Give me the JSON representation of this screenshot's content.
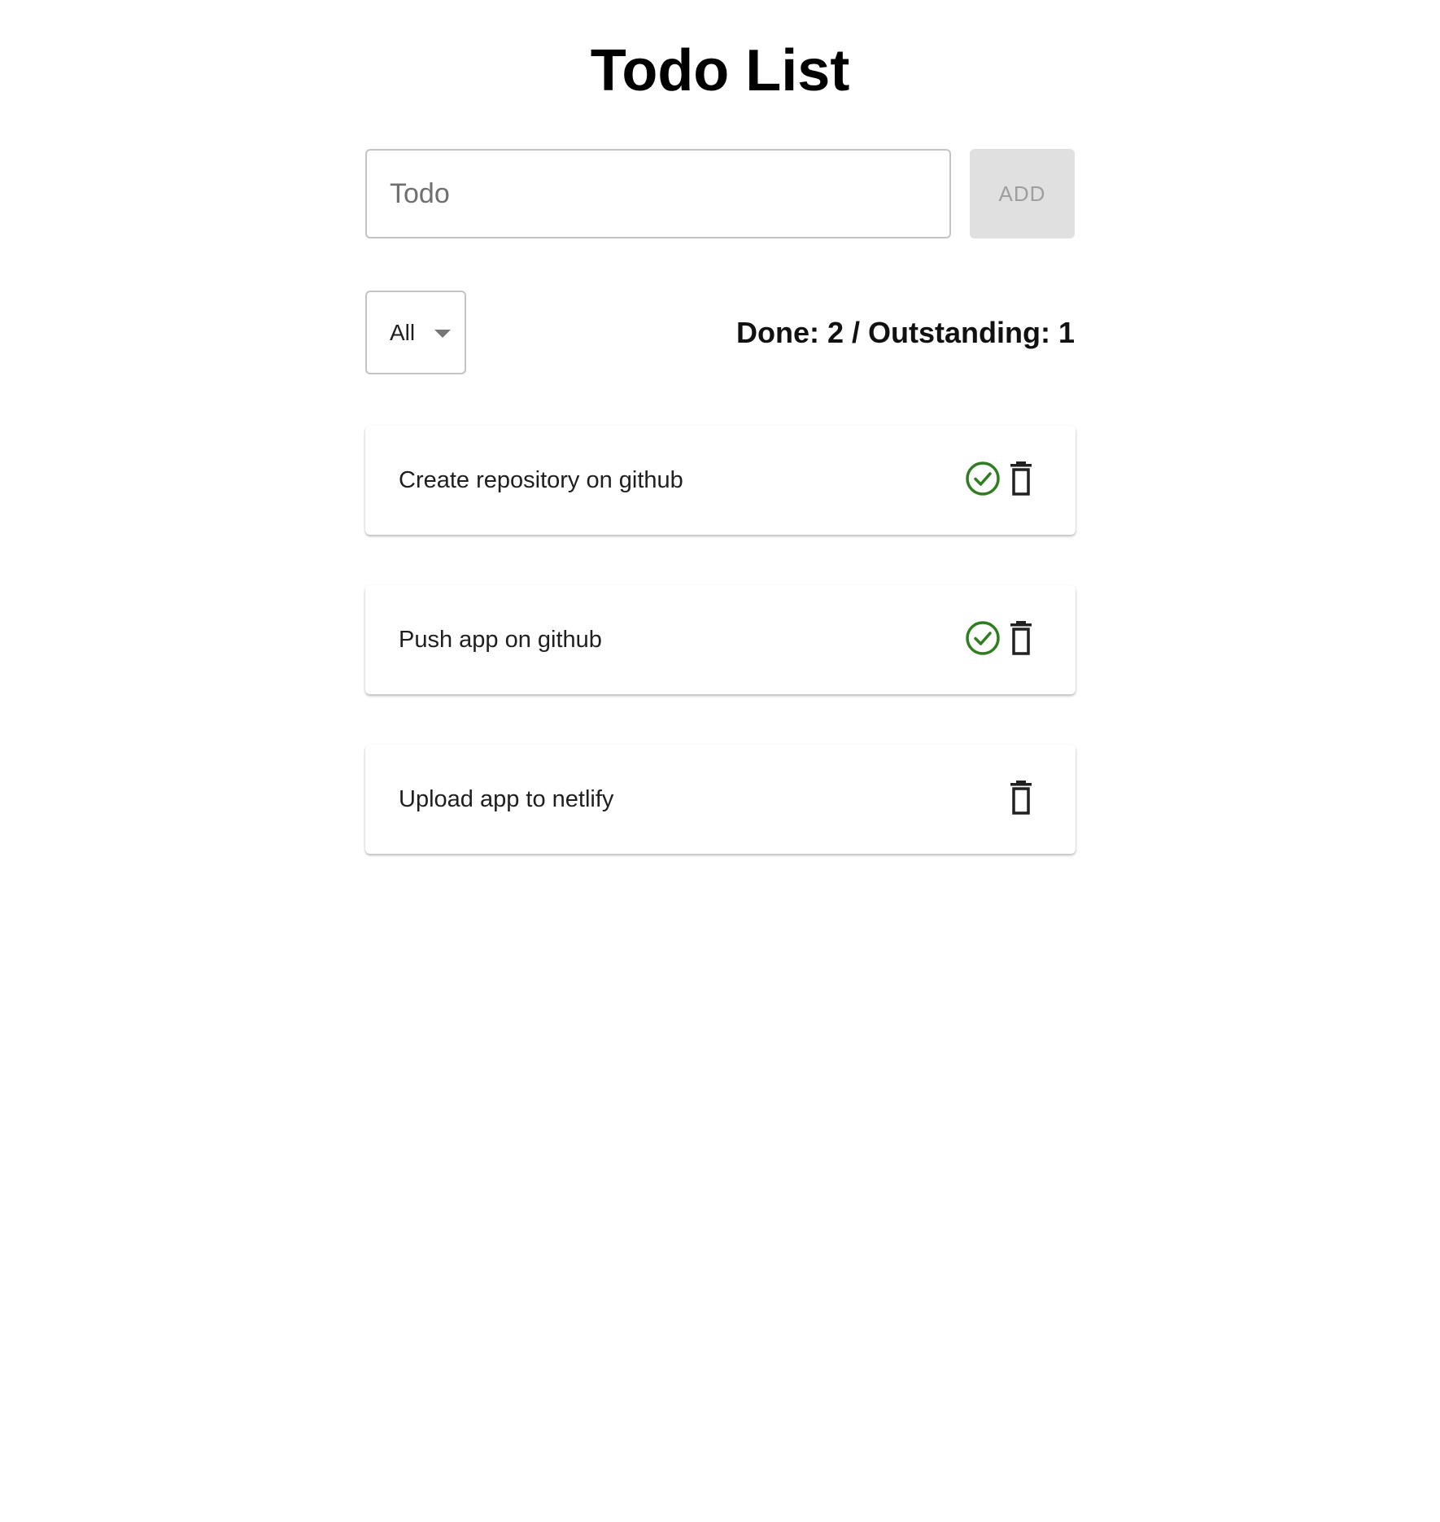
{
  "header": {
    "title": "Todo List"
  },
  "form": {
    "input_placeholder": "Todo",
    "input_value": "",
    "add_label": "ADD"
  },
  "filter": {
    "selected": "All"
  },
  "summary": {
    "text": "Done: 2 / Outstanding: 1"
  },
  "todos": [
    {
      "label": "Create repository on github",
      "done": true
    },
    {
      "label": "Push app on github",
      "done": true
    },
    {
      "label": "Upload app to netlify",
      "done": false
    }
  ],
  "icons": {
    "done": "check-circle-icon",
    "delete": "trash-icon"
  },
  "colors": {
    "done_green": "#2e7d1f",
    "icon_dark": "#212121"
  }
}
